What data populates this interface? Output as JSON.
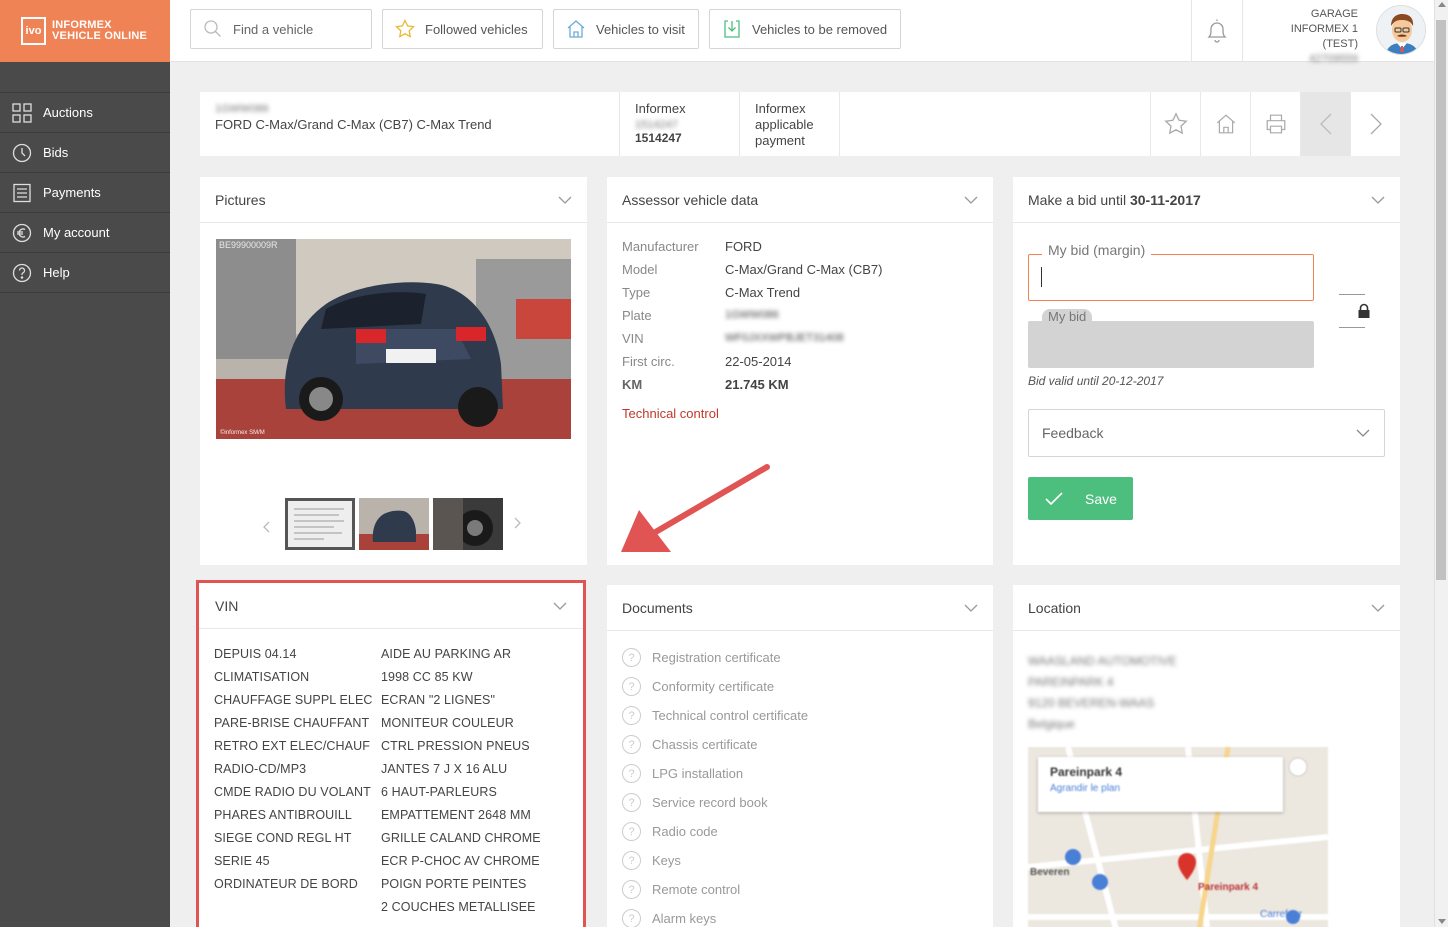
{
  "logo": {
    "badge": "ivo",
    "line1": "INFORMEX",
    "line2": "VEHICLE ONLINE"
  },
  "sidebar": {
    "items": [
      {
        "label": "Auctions",
        "icon": "grid-icon"
      },
      {
        "label": "Bids",
        "icon": "clock-icon"
      },
      {
        "label": "Payments",
        "icon": "document-icon"
      },
      {
        "label": "My account",
        "icon": "euro-icon"
      },
      {
        "label": "Help",
        "icon": "help-icon"
      }
    ]
  },
  "header": {
    "search_placeholder": "Find a vehicle",
    "followed": "Followed vehicles",
    "to_visit": "Vehicles to visit",
    "to_remove": "Vehicles to be removed",
    "garage_name": "GARAGE INFORMEX 1",
    "garage_sub": "(TEST)",
    "garage_id": "42709559"
  },
  "vehicle": {
    "plate_blurred": "1GWW086",
    "title": "FORD C-Max/Grand C-Max (CB7) C-Max Trend",
    "informex_label": "Informex",
    "informex_blurred": "1514247",
    "informex_number": "1514247",
    "payment_line1": "Informex",
    "payment_line2": "applicable",
    "payment_line3": "payment"
  },
  "pictures": {
    "title": "Pictures",
    "watermark_id": "BE99900009R",
    "watermark_copy": "©informex SM/M"
  },
  "assessor": {
    "title": "Assessor vehicle data",
    "rows": [
      {
        "label": "Manufacturer",
        "value": "FORD"
      },
      {
        "label": "Model",
        "value": "C-Max/Grand C-Max (CB7)"
      },
      {
        "label": "Type",
        "value": "C-Max Trend"
      },
      {
        "label": "Plate",
        "value": "1GWW086"
      },
      {
        "label": "VIN",
        "value": "WF0JXXWPBJET31408"
      },
      {
        "label": "First circ.",
        "value": "22-05-2014"
      },
      {
        "label": "KM",
        "value": "21.745 KM"
      }
    ],
    "technical_control": "Technical control"
  },
  "bid": {
    "title_prefix": "Make a bid until",
    "title_date": "30-11-2017",
    "margin_label": "My bid (margin)",
    "bid_label": "My bid",
    "valid_until": "Bid valid until 20-12-2017",
    "feedback": "Feedback",
    "save": "Save"
  },
  "vin": {
    "title": "VIN",
    "options": [
      "DEPUIS 04.14",
      "AIDE AU PARKING AR",
      "CLIMATISATION",
      "1998 CC 85 KW",
      "CHAUFFAGE SUPPL ELEC",
      "ECRAN \"2 LIGNES\"",
      "PARE-BRISE CHAUFFANT",
      "MONITEUR COULEUR",
      "RETRO EXT ELEC/CHAUF",
      "CTRL PRESSION PNEUS",
      "RADIO-CD/MP3",
      "JANTES 7 J X 16 ALU",
      "CMDE RADIO DU VOLANT",
      "6 HAUT-PARLEURS",
      "PHARES ANTIBROUILL",
      "EMPATTEMENT 2648 MM",
      "SIEGE COND REGL HT",
      "GRILLE CALAND CHROME",
      "SERIE 45",
      "ECR P-CHOC AV CHROME",
      "ORDINATEUR DE BORD",
      "POIGN PORTE PEINTES",
      "",
      "2 COUCHES METALLISEE"
    ]
  },
  "documents": {
    "title": "Documents",
    "items": [
      "Registration certificate",
      "Conformity certificate",
      "Technical control certificate",
      "Chassis certificate",
      "LPG installation",
      "Service record book",
      "Radio code",
      "Keys",
      "Remote control",
      "Alarm keys"
    ]
  },
  "location": {
    "title": "Location",
    "address": [
      "WAASLAND AUTOMOTIVE",
      "PAREINPARK 4",
      "9120 BEVEREN-WAAS",
      "Belgique"
    ],
    "map_title": "Pareinpark 4",
    "map_link": "Agrandir le plan",
    "map_town": "Beveren",
    "map_pin": "Pareinpark 4",
    "map_store": "Carrefour"
  },
  "colors": {
    "accent": "#f08356",
    "sidebar": "#4a4a4a",
    "save": "#4cbf7e",
    "highlight": "#e05454",
    "link": "#c0392b"
  }
}
